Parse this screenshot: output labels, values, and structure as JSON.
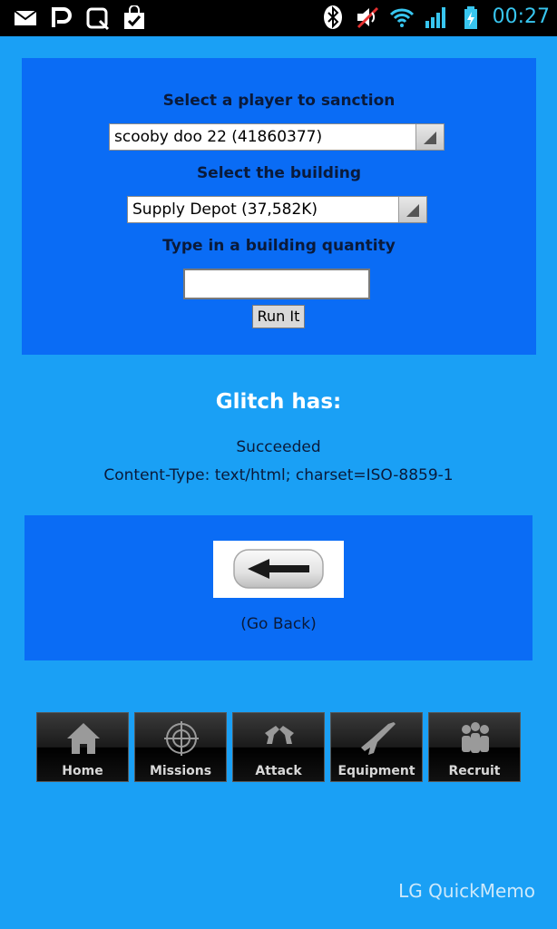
{
  "status_bar": {
    "time": "00:27",
    "left_icons": [
      "mail-icon",
      "pinterest-icon",
      "quickremote-icon",
      "shopping-bag-icon"
    ],
    "right_icons": [
      "bluetooth-icon",
      "muted-icon",
      "wifi-icon",
      "signal-icon",
      "battery-icon"
    ]
  },
  "form": {
    "player_label": "Select a player to sanction",
    "player_selected": "scooby doo 22 (41860377)",
    "building_label": "Select the building",
    "building_selected": "Supply Depot (37,582K)",
    "quantity_label": "Type in a building quantity",
    "quantity_value": "",
    "run_label": "Run It"
  },
  "result": {
    "title": "Glitch has:",
    "status": "Succeeded",
    "content_type": "Content-Type: text/html; charset=ISO-8859-1"
  },
  "back": {
    "caption": "(Go Back)"
  },
  "nav": {
    "items": [
      {
        "label": "Home",
        "icon": "home-icon"
      },
      {
        "label": "Missions",
        "icon": "crosshair-icon"
      },
      {
        "label": "Attack",
        "icon": "pistols-icon"
      },
      {
        "label": "Equipment",
        "icon": "rifle-icon"
      },
      {
        "label": "Recruit",
        "icon": "people-icon"
      }
    ]
  },
  "watermark": "LG QuickMemo",
  "colors": {
    "background": "#1aa0f5",
    "panel": "#0a6cf5",
    "status_time": "#38c6f0"
  }
}
